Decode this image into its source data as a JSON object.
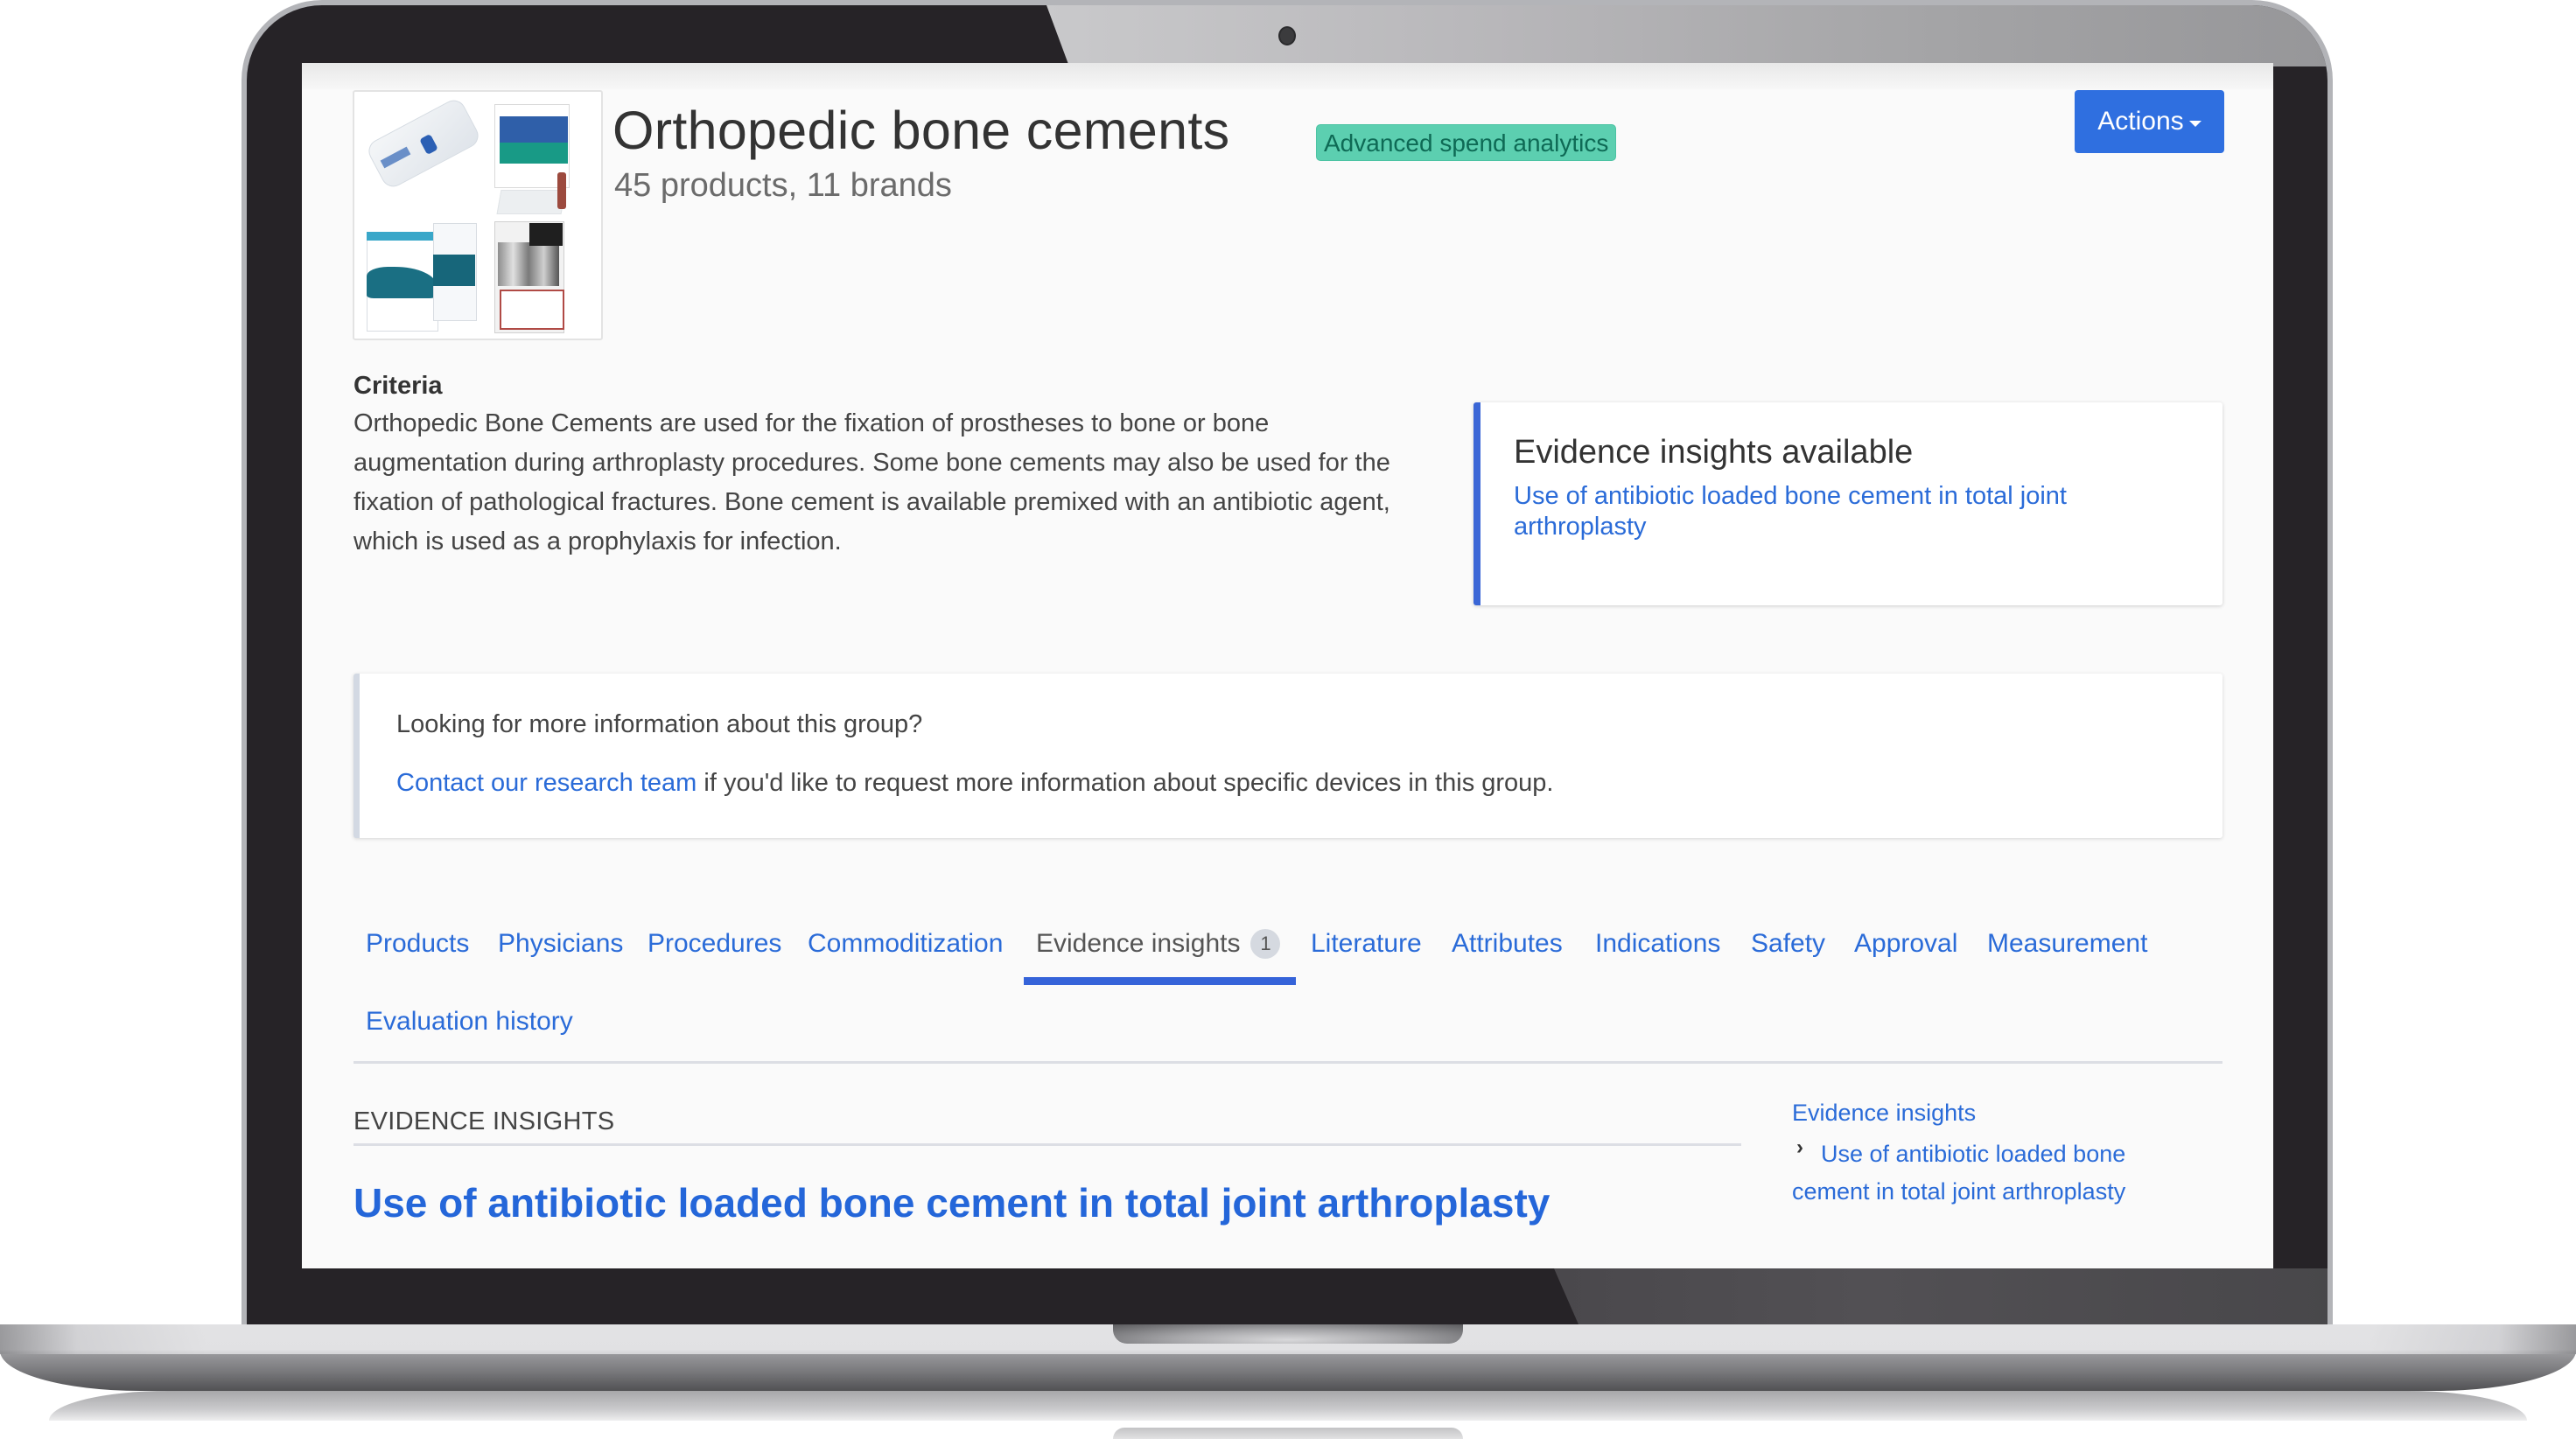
{
  "header": {
    "title": "Orthopedic bone cements",
    "subtitle": "45 products, 11 brands",
    "badge": "Advanced spend analytics",
    "actions_label": "Actions",
    "thumbnail_alt": "product-collage"
  },
  "criteria": {
    "heading": "Criteria",
    "text": "Orthopedic Bone Cements are used for the fixation of prostheses to bone or bone augmentation during arthroplasty procedures. Some bone cements may also be used for the fixation of pathological fractures. Bone cement is available premixed with an antibiotic agent, which is used as a prophylaxis for infection."
  },
  "evidence_card": {
    "heading": "Evidence insights available",
    "link": "Use of antibiotic loaded bone cement in total joint arthroplasty"
  },
  "info_box": {
    "question": "Looking for more information about this group?",
    "link": "Contact our research team",
    "text": " if you'd like to request more information about specific devices in this group."
  },
  "tabs": [
    {
      "label": "Products"
    },
    {
      "label": "Physicians"
    },
    {
      "label": "Procedures"
    },
    {
      "label": "Commoditization"
    },
    {
      "label": "Evidence insights",
      "badge": "1",
      "active": true
    },
    {
      "label": "Literature"
    },
    {
      "label": "Attributes"
    },
    {
      "label": "Indications"
    },
    {
      "label": "Safety"
    },
    {
      "label": "Approval"
    },
    {
      "label": "Measurement"
    },
    {
      "label": "Evaluation history"
    }
  ],
  "section": {
    "label": "EVIDENCE INSIGHTS",
    "title": "Use of antibiotic loaded bone cement in total joint arthroplasty"
  },
  "toc": {
    "root": "Evidence insights",
    "chevron_icon": "›",
    "item": "Use of antibiotic loaded bone cement in total joint arthroplasty"
  },
  "colors": {
    "accent": "#2f6fe0",
    "link": "#2a6bd8",
    "badge_bg": "#5ccfb0",
    "badge_text": "#0e6a55",
    "tab_underline": "#3563d9"
  }
}
